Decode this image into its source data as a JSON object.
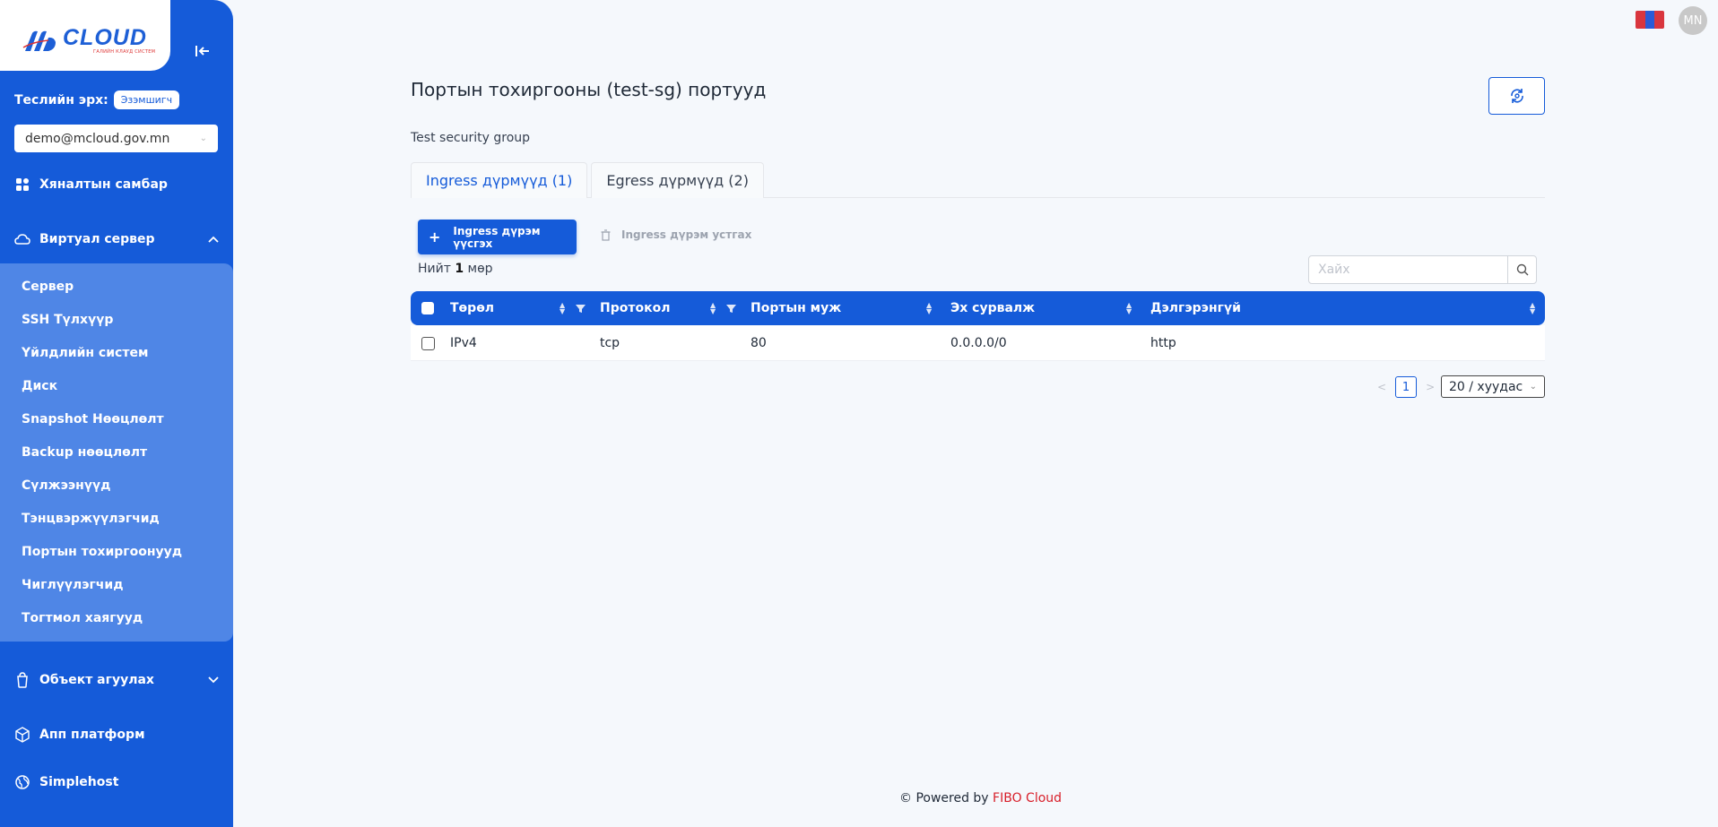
{
  "brand": {
    "logo_text": "CLOUD",
    "logo_sub": "ГАЛИЙН КЛАУД СИСТЕМ"
  },
  "sidebar": {
    "role_label": "Теслийн эрх:",
    "role_badge": "Эзэмшигч",
    "account": "demo@mcloud.gov.mn",
    "items": [
      {
        "label": "Хяналтын самбар",
        "icon": "dashboard-icon"
      },
      {
        "label": "Виртуал сервер",
        "icon": "cloud-icon"
      },
      {
        "label": "Объект агуулах",
        "icon": "bucket-icon"
      },
      {
        "label": "Апп платформ",
        "icon": "cube-icon"
      },
      {
        "label": "Simplehost",
        "icon": "globe-icon"
      }
    ],
    "submenu": [
      "Сервер",
      "SSH Түлхүүр",
      "Үйлдлийн систем",
      "Диск",
      "Snapshot Нөөцлөлт",
      "Backup нөөцлөлт",
      "Сүлжээнүүд",
      "Тэнцвэржүүлэгчид",
      "Портын тохиргоонууд",
      "Чиглүүлэгчид",
      "Тогтмол хаягууд"
    ]
  },
  "header": {
    "avatar": "MN"
  },
  "main": {
    "title": "Портын тохиргооны (test-sg) портууд",
    "description": "Test security group",
    "tabs": [
      {
        "label": "Ingress дүрмүүд (1)",
        "active": true
      },
      {
        "label": "Egress дүрмүүд (2)",
        "active": false
      }
    ],
    "add_button": "Ingress дүрэм үүсгэх",
    "delete_button": "Ingress дүрэм устгах",
    "total_prefix": "Нийт",
    "total_count": "1",
    "total_suffix": "мөр",
    "search_placeholder": "Хайх"
  },
  "table": {
    "columns": [
      "Төрөл",
      "Протокол",
      "Портын муж",
      "Эх сурвалж",
      "Дэлгэрэнгүй"
    ],
    "rows": [
      [
        "IPv4",
        "tcp",
        "80",
        "0.0.0.0/0",
        "http"
      ]
    ]
  },
  "pagination": {
    "current": "1",
    "page_size": "20 / хуудас"
  },
  "footer": {
    "prefix": "© Powered by",
    "brand": "FIBO Cloud"
  },
  "colors": {
    "primary": "#155bd9",
    "submenu_bg": "#4f86e6",
    "footer_brand": "#d81f2a"
  }
}
